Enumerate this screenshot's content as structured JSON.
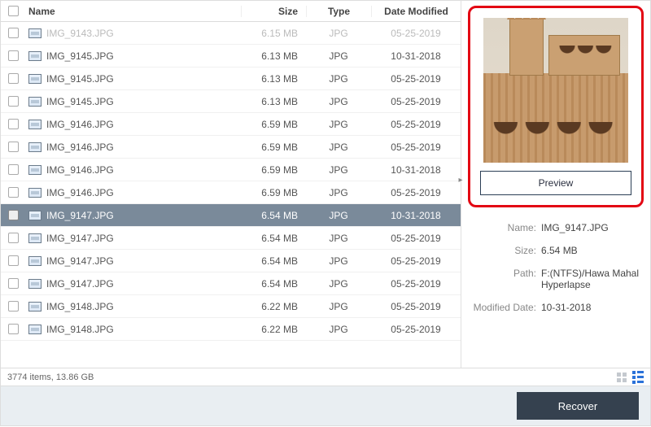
{
  "columns": {
    "name": "Name",
    "size": "Size",
    "type": "Type",
    "date": "Date Modified"
  },
  "rows": [
    {
      "name": "IMG_9143.JPG",
      "size": "6.15  MB",
      "type": "JPG",
      "date": "05-25-2019",
      "selected": false,
      "dim": true
    },
    {
      "name": "IMG_9145.JPG",
      "size": "6.13  MB",
      "type": "JPG",
      "date": "10-31-2018",
      "selected": false
    },
    {
      "name": "IMG_9145.JPG",
      "size": "6.13  MB",
      "type": "JPG",
      "date": "05-25-2019",
      "selected": false
    },
    {
      "name": "IMG_9145.JPG",
      "size": "6.13  MB",
      "type": "JPG",
      "date": "05-25-2019",
      "selected": false
    },
    {
      "name": "IMG_9146.JPG",
      "size": "6.59  MB",
      "type": "JPG",
      "date": "05-25-2019",
      "selected": false
    },
    {
      "name": "IMG_9146.JPG",
      "size": "6.59  MB",
      "type": "JPG",
      "date": "05-25-2019",
      "selected": false
    },
    {
      "name": "IMG_9146.JPG",
      "size": "6.59  MB",
      "type": "JPG",
      "date": "10-31-2018",
      "selected": false
    },
    {
      "name": "IMG_9146.JPG",
      "size": "6.59  MB",
      "type": "JPG",
      "date": "05-25-2019",
      "selected": false
    },
    {
      "name": "IMG_9147.JPG",
      "size": "6.54  MB",
      "type": "JPG",
      "date": "10-31-2018",
      "selected": true
    },
    {
      "name": "IMG_9147.JPG",
      "size": "6.54  MB",
      "type": "JPG",
      "date": "05-25-2019",
      "selected": false
    },
    {
      "name": "IMG_9147.JPG",
      "size": "6.54  MB",
      "type": "JPG",
      "date": "05-25-2019",
      "selected": false
    },
    {
      "name": "IMG_9147.JPG",
      "size": "6.54  MB",
      "type": "JPG",
      "date": "05-25-2019",
      "selected": false
    },
    {
      "name": "IMG_9148.JPG",
      "size": "6.22  MB",
      "type": "JPG",
      "date": "05-25-2019",
      "selected": false
    },
    {
      "name": "IMG_9148.JPG",
      "size": "6.22  MB",
      "type": "JPG",
      "date": "05-25-2019",
      "selected": false
    }
  ],
  "preview_button": "Preview",
  "meta_labels": {
    "name": "Name:",
    "size": "Size:",
    "path": "Path:",
    "modified": "Modified Date:"
  },
  "meta": {
    "name": "IMG_9147.JPG",
    "size": "6.54  MB",
    "path": "F:(NTFS)/Hawa Mahal Hyperlapse",
    "modified": "10-31-2018"
  },
  "status": "3774 items, 13.86  GB",
  "recover_label": "Recover"
}
